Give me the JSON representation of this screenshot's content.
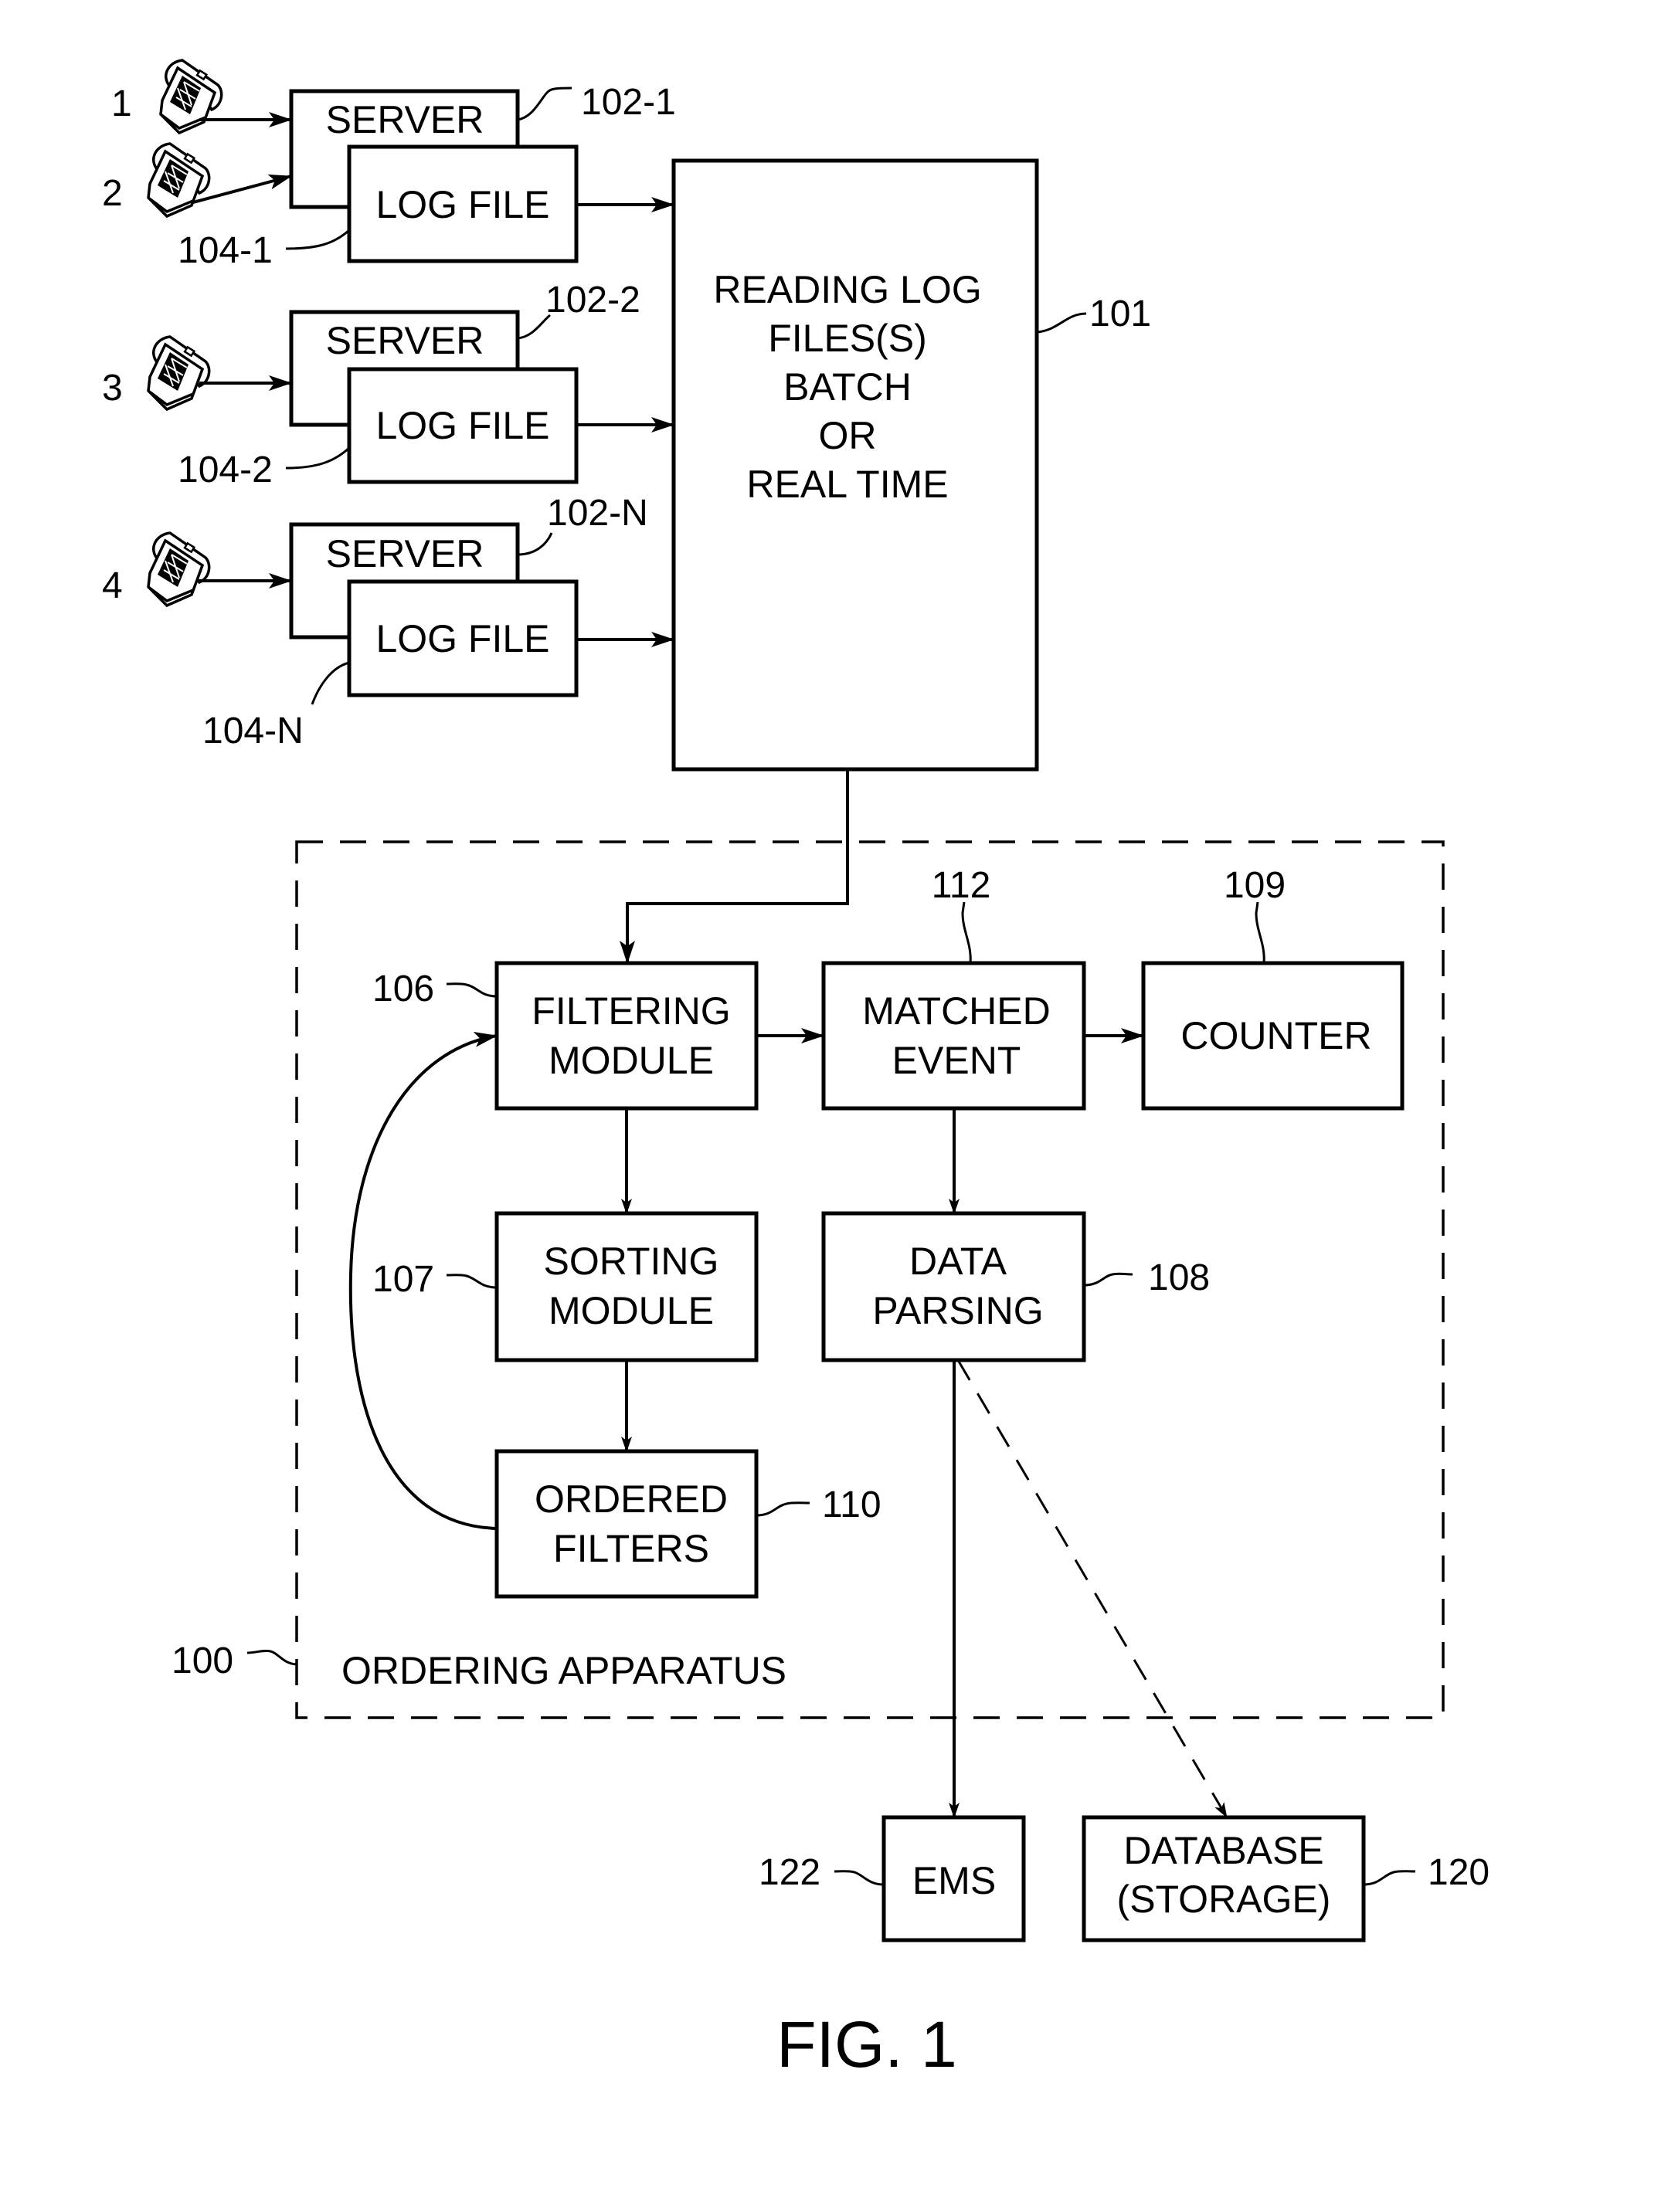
{
  "figure": {
    "caption": "FIG. 1",
    "apparatus_label": "ORDERING APPARATUS",
    "apparatus_ref": "100"
  },
  "phones": [
    {
      "label": "1"
    },
    {
      "label": "2"
    },
    {
      "label": "3"
    },
    {
      "label": "4"
    }
  ],
  "servers": [
    {
      "server_label": "SERVER",
      "server_ref": "102-1",
      "log_label": "LOG FILE",
      "log_ref": "104-1"
    },
    {
      "server_label": "SERVER",
      "server_ref": "102-2",
      "log_label": "LOG FILE",
      "log_ref": "104-2"
    },
    {
      "server_label": "SERVER",
      "server_ref": "102-N",
      "log_label": "LOG FILE",
      "log_ref": "104-N"
    }
  ],
  "reader": {
    "lines": [
      "READING LOG",
      "FILES(S)",
      "BATCH",
      "OR",
      "REAL TIME"
    ],
    "ref": "101"
  },
  "modules": {
    "filtering": {
      "lines": [
        "FILTERING",
        "MODULE"
      ],
      "ref": "106"
    },
    "matched": {
      "lines": [
        "MATCHED",
        "EVENT"
      ],
      "ref": "112"
    },
    "counter": {
      "lines": [
        "COUNTER"
      ],
      "ref": "109"
    },
    "sorting": {
      "lines": [
        "SORTING",
        "MODULE"
      ],
      "ref": "107"
    },
    "parsing": {
      "lines": [
        "DATA",
        "PARSING"
      ],
      "ref": "108"
    },
    "ordered": {
      "lines": [
        "ORDERED",
        "FILTERS"
      ],
      "ref": "110"
    },
    "ems": {
      "lines": [
        "EMS"
      ],
      "ref": "122"
    },
    "database": {
      "lines": [
        "DATABASE",
        "(STORAGE)"
      ],
      "ref": "120"
    }
  }
}
